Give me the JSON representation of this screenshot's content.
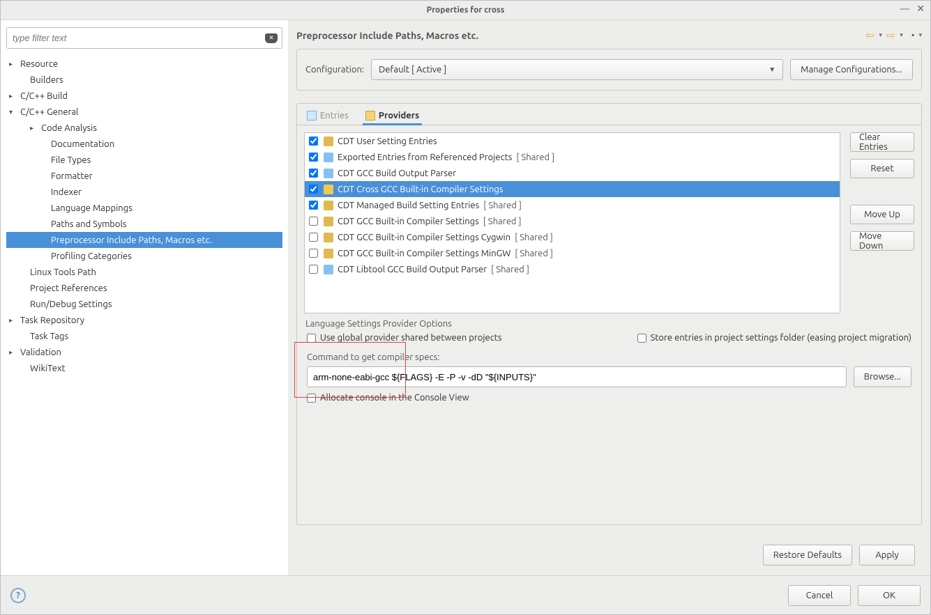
{
  "window": {
    "title": "Properties for cross"
  },
  "filter": {
    "placeholder": "type filter text"
  },
  "tree": [
    {
      "label": "Resource",
      "level": 0,
      "arrow": "▸"
    },
    {
      "label": "Builders",
      "level": 0,
      "arrow": ""
    },
    {
      "label": "C/C++ Build",
      "level": 0,
      "arrow": "▸"
    },
    {
      "label": "C/C++ General",
      "level": 0,
      "arrow": "▾"
    },
    {
      "label": "Code Analysis",
      "level": 1,
      "arrow": "▸"
    },
    {
      "label": "Documentation",
      "level": 1,
      "arrow": ""
    },
    {
      "label": "File Types",
      "level": 1,
      "arrow": ""
    },
    {
      "label": "Formatter",
      "level": 1,
      "arrow": ""
    },
    {
      "label": "Indexer",
      "level": 1,
      "arrow": ""
    },
    {
      "label": "Language Mappings",
      "level": 1,
      "arrow": ""
    },
    {
      "label": "Paths and Symbols",
      "level": 1,
      "arrow": ""
    },
    {
      "label": "Preprocessor Include Paths, Macros etc.",
      "level": 1,
      "arrow": "",
      "selected": true
    },
    {
      "label": "Profiling Categories",
      "level": 1,
      "arrow": ""
    },
    {
      "label": "Linux Tools Path",
      "level": 0,
      "arrow": ""
    },
    {
      "label": "Project References",
      "level": 0,
      "arrow": ""
    },
    {
      "label": "Run/Debug Settings",
      "level": 0,
      "arrow": ""
    },
    {
      "label": "Task Repository",
      "level": 0,
      "arrow": "▸"
    },
    {
      "label": "Task Tags",
      "level": 0,
      "arrow": ""
    },
    {
      "label": "Validation",
      "level": 0,
      "arrow": "▸"
    },
    {
      "label": "WikiText",
      "level": 0,
      "arrow": ""
    }
  ],
  "header": {
    "title": "Preprocessor Include Paths, Macros etc."
  },
  "config": {
    "label": "Configuration:",
    "selected": "Default  [ Active ]",
    "manage": "Manage Configurations..."
  },
  "tabs": {
    "entries": "Entries",
    "providers": "Providers"
  },
  "providers": [
    {
      "checked": true,
      "label": "CDT User Setting Entries",
      "suffix": "",
      "iconColor": "#e2b94f"
    },
    {
      "checked": true,
      "label": "Exported Entries from Referenced Projects",
      "suffix": "[ Shared ]",
      "iconColor": "#88bff2"
    },
    {
      "checked": true,
      "label": "CDT GCC Build Output Parser",
      "suffix": "",
      "iconColor": "#88bff2"
    },
    {
      "checked": true,
      "label": "CDT Cross GCC Built-in Compiler Settings",
      "suffix": "",
      "iconColor": "#f5c94e",
      "selected": true
    },
    {
      "checked": true,
      "label": "CDT Managed Build Setting Entries",
      "suffix": "[ Shared ]",
      "iconColor": "#e2b94f"
    },
    {
      "checked": false,
      "label": "CDT GCC Built-in Compiler Settings",
      "suffix": "[ Shared ]",
      "iconColor": "#e2b94f"
    },
    {
      "checked": false,
      "label": "CDT GCC Built-in Compiler Settings Cygwin",
      "suffix": "[ Shared ]",
      "iconColor": "#e2b94f"
    },
    {
      "checked": false,
      "label": "CDT GCC Built-in Compiler Settings MinGW",
      "suffix": "[ Shared ]",
      "iconColor": "#e2b94f"
    },
    {
      "checked": false,
      "label": "CDT Libtool GCC Build Output Parser",
      "suffix": "[ Shared ]",
      "iconColor": "#88bff2"
    }
  ],
  "sideButtons": {
    "clear": "Clear Entries",
    "reset": "Reset",
    "moveUp": "Move Up",
    "moveDown": "Move Down"
  },
  "options": {
    "sectionLabel": "Language Settings Provider Options",
    "useGlobal": "Use global provider shared between projects",
    "storeEntries": "Store entries in project settings folder (easing project migration)",
    "cmdLabel": "Command to get compiler specs:",
    "cmdValue": "arm-none-eabi-gcc ${FLAGS} -E -P -v -dD \"${INPUTS}\"",
    "browse": "Browse...",
    "allocate": "Allocate console in the Console View"
  },
  "bottom": {
    "restore": "Restore Defaults",
    "apply": "Apply"
  },
  "footer": {
    "cancel": "Cancel",
    "ok": "OK"
  }
}
